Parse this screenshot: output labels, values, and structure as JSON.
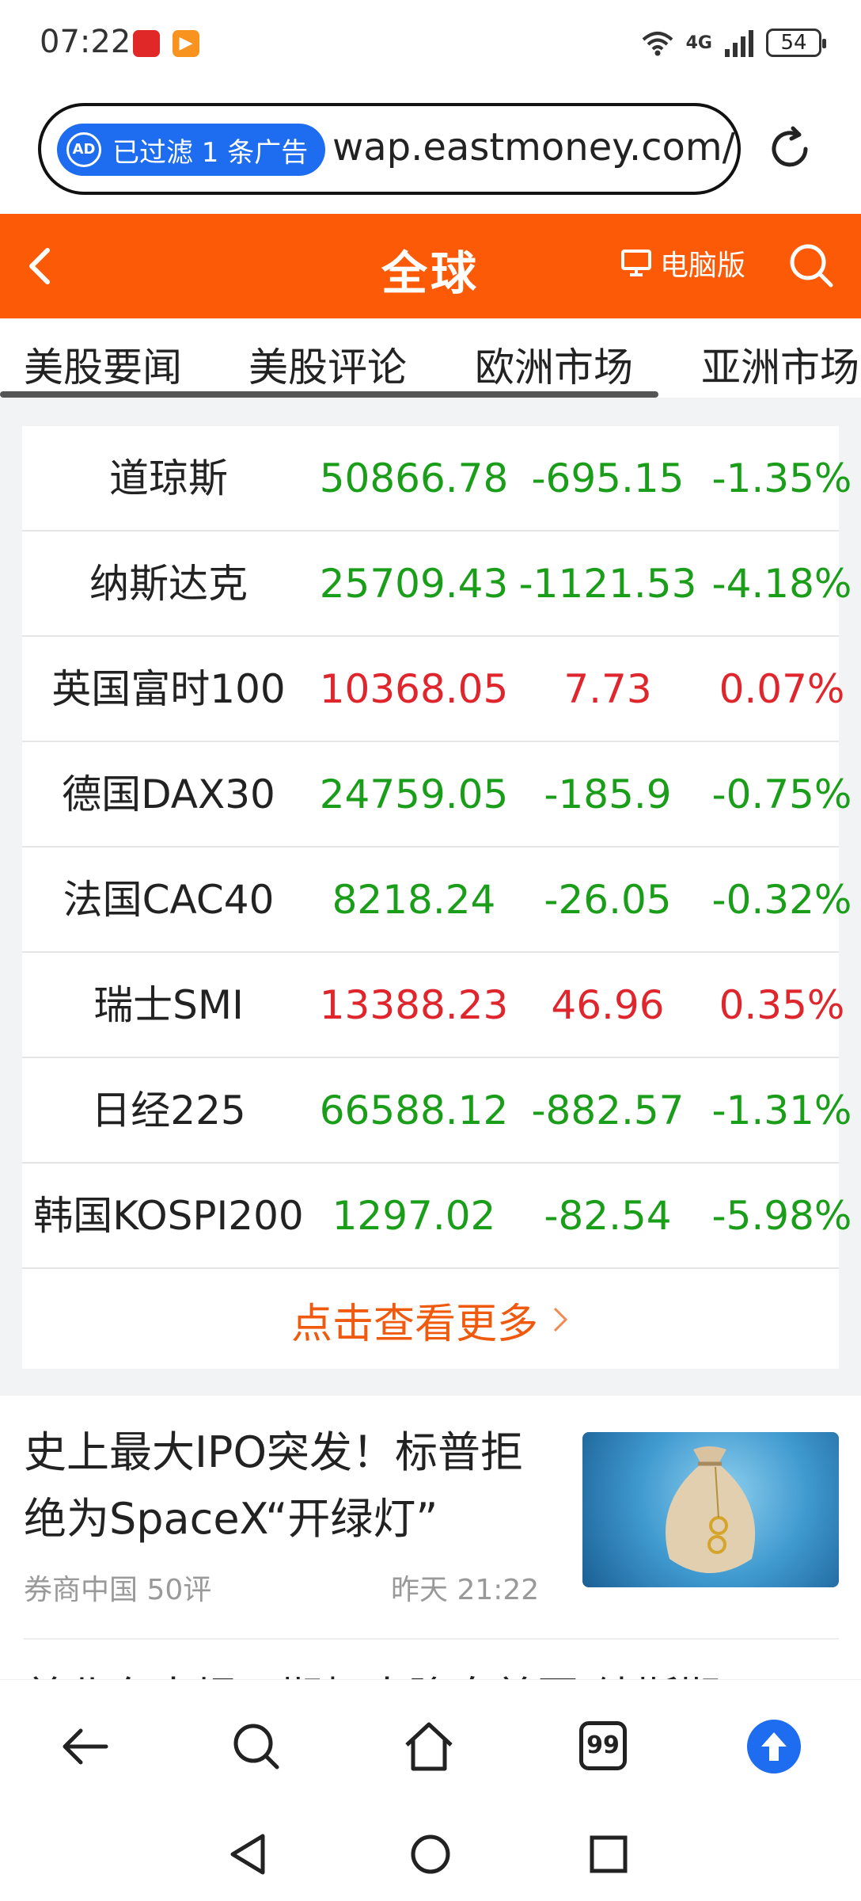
{
  "status_bar": {
    "time": "07:22",
    "signal_label": "4G",
    "battery": "54"
  },
  "url_bar": {
    "ad_filter_text": "已过滤 1 条广告",
    "ad_icon_text": "AD",
    "url": "wap.eastmoney.com/"
  },
  "header": {
    "title": "全球",
    "pc_version_label": "电脑版"
  },
  "tabs": [
    "美股要闻",
    "美股评论",
    "欧洲市场",
    "亚洲市场"
  ],
  "markets": [
    {
      "name": "道琼斯",
      "price": "50866.78",
      "change": "-695.15",
      "pct": "-1.35%",
      "dir": "down"
    },
    {
      "name": "纳斯达克",
      "price": "25709.43",
      "change": "-1121.53",
      "pct": "-4.18%",
      "dir": "down"
    },
    {
      "name": "英国富时100",
      "price": "10368.05",
      "change": "7.73",
      "pct": "0.07%",
      "dir": "up"
    },
    {
      "name": "德国DAX30",
      "price": "24759.05",
      "change": "-185.9",
      "pct": "-0.75%",
      "dir": "down"
    },
    {
      "name": "法国CAC40",
      "price": "8218.24",
      "change": "-26.05",
      "pct": "-0.32%",
      "dir": "down"
    },
    {
      "name": "瑞士SMI",
      "price": "13388.23",
      "change": "46.96",
      "pct": "0.35%",
      "dir": "up"
    },
    {
      "name": "日经225",
      "price": "66588.12",
      "change": "-882.57",
      "pct": "-1.31%",
      "dir": "down"
    },
    {
      "name": "韩国KOSPI200",
      "price": "1297.02",
      "change": "-82.54",
      "pct": "-5.98%",
      "dir": "down"
    }
  ],
  "more_label": "点击查看更多",
  "news": [
    {
      "title": "史上最大IPO突发！标普拒绝为SpaceX“开绿灯”",
      "source": "券商中国 50评",
      "time": "昨天 21:22"
    },
    {
      "title": "美北东大坝开期极大降息美国 纳斯期"
    }
  ],
  "tab_count": "99",
  "colors": {
    "brand_orange": "#fc5a06",
    "down_green": "#1a9e1a",
    "up_red": "#e0262d",
    "link_orange": "#f05a0f",
    "accent_blue": "#1e6cf0"
  },
  "icons": {
    "back": "chevron-left-icon",
    "search": "search-icon",
    "pc": "monitor-icon",
    "reload": "reload-icon",
    "nav_back": "arrow-left-icon",
    "nav_home": "home-icon",
    "nav_up": "arrow-up-icon"
  }
}
